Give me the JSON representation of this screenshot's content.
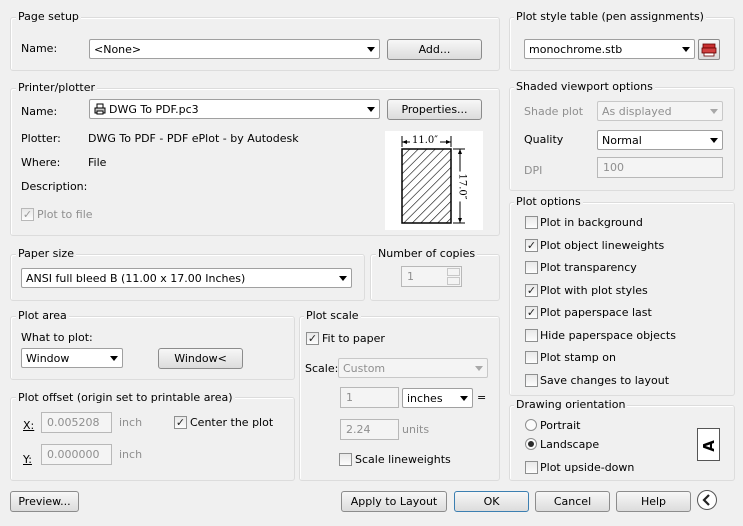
{
  "page_setup": {
    "title": "Page setup",
    "name_label": "Name:",
    "name_value": "<None>",
    "add_button": "Add..."
  },
  "printer": {
    "title": "Printer/plotter",
    "name_label": "Name:",
    "name_value": "DWG To PDF.pc3",
    "properties_button": "Properties...",
    "plotter_label": "Plotter:",
    "plotter_value": "DWG To PDF - PDF ePlot - by Autodesk",
    "where_label": "Where:",
    "where_value": "File",
    "description_label": "Description:",
    "plot_to_file": "Plot to file",
    "plot_to_file_checked": true,
    "preview_width": "11.0″",
    "preview_height": "17.0″"
  },
  "paper_size": {
    "title": "Paper size",
    "value": "ANSI full bleed B (11.00 x 17.00 Inches)"
  },
  "copies": {
    "title": "Number of copies",
    "value": "1"
  },
  "plot_area": {
    "title": "Plot area",
    "what_label": "What to plot:",
    "what_value": "Window",
    "window_button": "Window<"
  },
  "plot_offset": {
    "title": "Plot offset (origin set to printable area)",
    "x_label": "X:",
    "x_value": "0.005208",
    "x_unit": "inch",
    "y_label": "Y:",
    "y_value": "0.000000",
    "y_unit": "inch",
    "center": "Center the plot",
    "center_checked": true
  },
  "plot_scale": {
    "title": "Plot scale",
    "fit": "Fit to paper",
    "fit_checked": true,
    "scale_label": "Scale:",
    "scale_value": "Custom",
    "num": "1",
    "unit_value": "inches",
    "equals": "=",
    "den": "2.24",
    "den_unit": "units",
    "scale_lw": "Scale lineweights",
    "scale_lw_checked": false
  },
  "plot_style": {
    "title": "Plot style table (pen assignments)",
    "value": "monochrome.stb"
  },
  "shaded": {
    "title": "Shaded viewport options",
    "shade_label": "Shade plot",
    "shade_value": "As displayed",
    "quality_label": "Quality",
    "quality_value": "Normal",
    "dpi_label": "DPI",
    "dpi_value": "100"
  },
  "plot_options": {
    "title": "Plot options",
    "items": [
      {
        "label": "Plot in background",
        "checked": false
      },
      {
        "label": "Plot object lineweights",
        "checked": true
      },
      {
        "label": "Plot transparency",
        "checked": false
      },
      {
        "label": "Plot with plot styles",
        "checked": true
      },
      {
        "label": "Plot paperspace last",
        "checked": true
      },
      {
        "label": "Hide paperspace objects",
        "checked": false
      },
      {
        "label": "Plot stamp on",
        "checked": false
      },
      {
        "label": "Save changes to layout",
        "checked": false
      }
    ]
  },
  "orientation": {
    "title": "Drawing orientation",
    "portrait": "Portrait",
    "landscape": "Landscape",
    "selected": "Landscape",
    "upside_down": "Plot upside-down",
    "upside_down_checked": false,
    "icon_letter": "A"
  },
  "footer": {
    "preview": "Preview...",
    "apply": "Apply to Layout",
    "ok": "OK",
    "cancel": "Cancel",
    "help": "Help"
  },
  "glyphs": {
    "check": "✓"
  }
}
